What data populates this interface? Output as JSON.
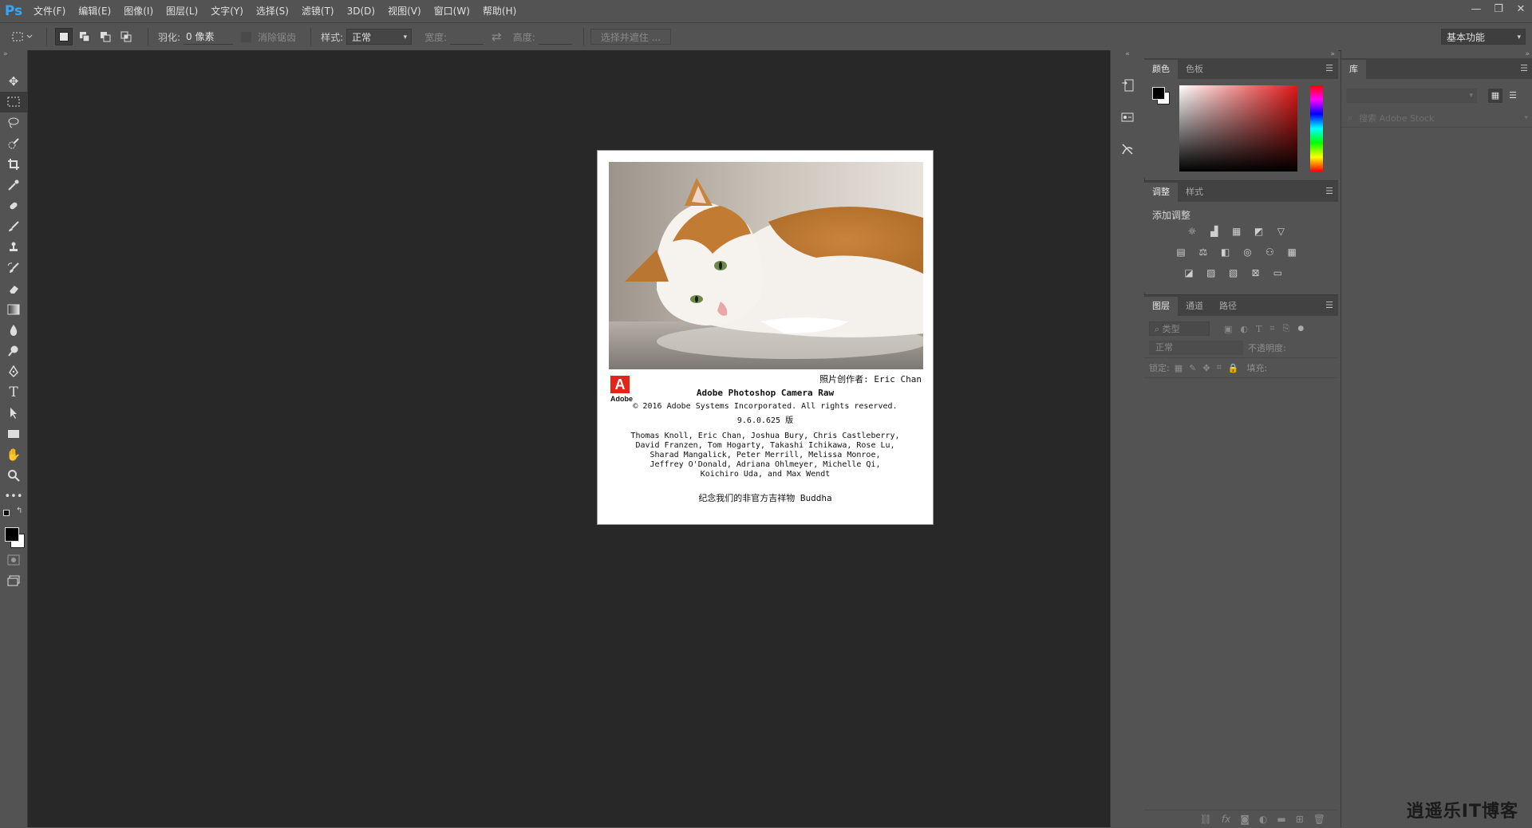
{
  "app": {
    "logo": "Ps"
  },
  "menu": [
    "文件(F)",
    "编辑(E)",
    "图像(I)",
    "图层(L)",
    "文字(Y)",
    "选择(S)",
    "滤镜(T)",
    "3D(D)",
    "视图(V)",
    "窗口(W)",
    "帮助(H)"
  ],
  "window_controls": {
    "minimize": "—",
    "restore": "❐",
    "close": "✕"
  },
  "options": {
    "feather_label": "羽化:",
    "feather_value": "0 像素",
    "antialias_label": "消除锯齿",
    "style_label": "样式:",
    "style_value": "正常",
    "width_label": "宽度:",
    "swap_icon": "⇄",
    "height_label": "高度:",
    "select_mask_button": "选择并遮住 ...",
    "workspace_value": "基本功能"
  },
  "splash": {
    "photo_credit": "照片创作者: Eric Chan",
    "logo_mark": "A",
    "logo_text": "Adobe",
    "product": "Adobe Photoshop Camera Raw",
    "copyright": "© 2016 Adobe Systems Incorporated. All rights reserved.",
    "version": "9.6.0.625 版",
    "credits": [
      "Thomas Knoll, Eric Chan, Joshua Bury, Chris Castleberry,",
      "David Franzen, Tom Hogarty, Takashi Ichikawa, Rose Lu,",
      "Sharad Mangalick, Peter Merrill, Melissa Monroe,",
      "Jeffrey O'Donald, Adriana Ohlmeyer, Michelle Qi,",
      "Koichiro Uda, and Max Wendt"
    ],
    "mascot": "纪念我们的非官方吉祥物 Buddha"
  },
  "color_panel": {
    "tabs": [
      "颜色",
      "色板"
    ]
  },
  "adjust_panel": {
    "tabs": [
      "调整",
      "样式"
    ],
    "heading": "添加调整"
  },
  "layers_panel": {
    "tabs": [
      "图层",
      "通道",
      "路径"
    ],
    "filter_placeholder": "类型",
    "blend_mode": "正常",
    "opacity_label": "不透明度:",
    "lock_label": "锁定:",
    "fill_label": "填充:"
  },
  "library_panel": {
    "tab": "库",
    "search_placeholder": "搜索 Adobe Stock"
  },
  "watermark": "逍遥乐IT博客",
  "colors": {
    "ps_blue": "#31a8ff",
    "adobe_red": "#e1251b"
  }
}
